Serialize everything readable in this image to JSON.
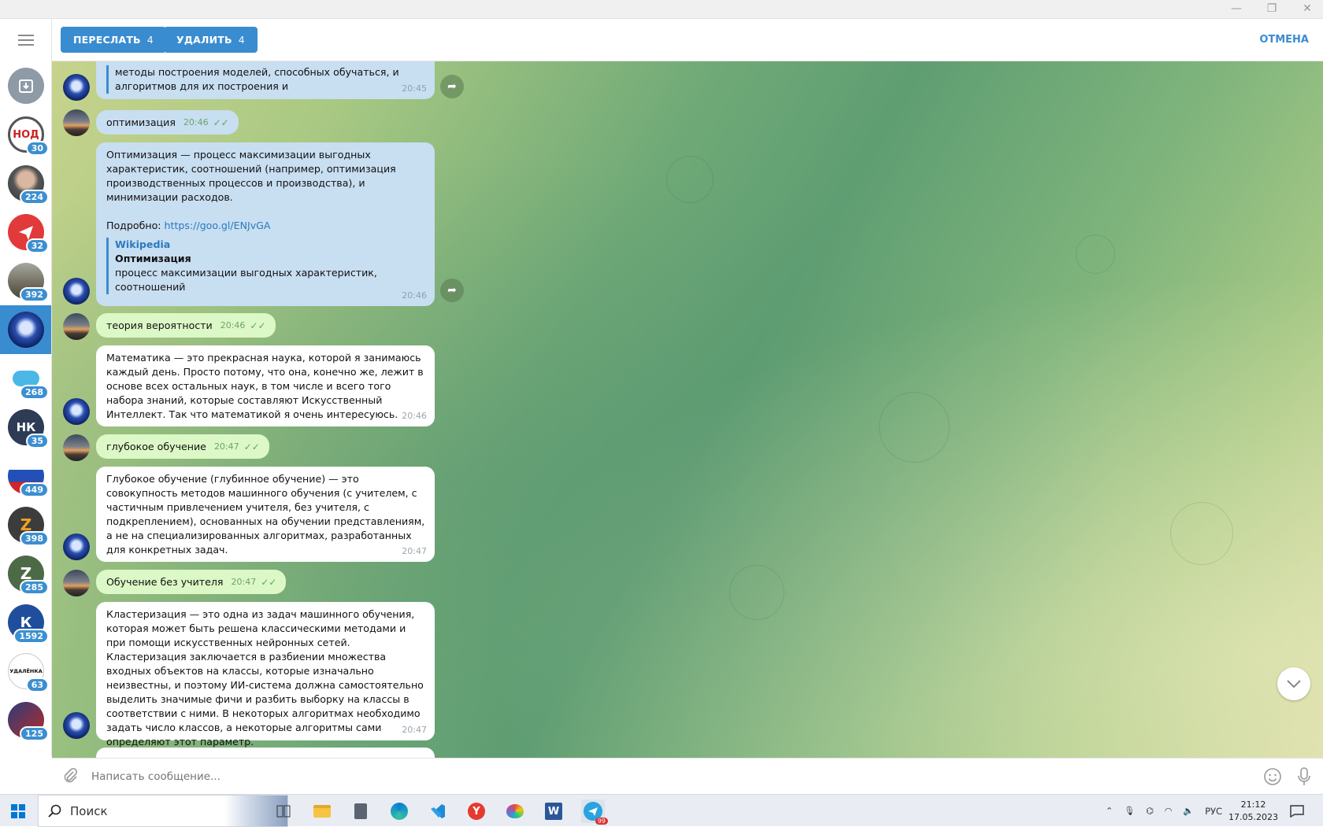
{
  "topbar": {
    "forward_label": "ПЕРЕСЛАТЬ",
    "forward_count": "4",
    "delete_label": "УДАЛИТЬ",
    "delete_count": "4",
    "cancel_label": "ОТМЕНА"
  },
  "sidebar": {
    "chats": [
      {
        "name": "archive",
        "badge": ""
      },
      {
        "name": "nod",
        "badge": "30",
        "label": "НОД"
      },
      {
        "name": "man-portrait",
        "badge": "224"
      },
      {
        "name": "red-channel",
        "badge": "32"
      },
      {
        "name": "soldier",
        "badge": "392"
      },
      {
        "name": "ai-bot",
        "badge": "",
        "active": true
      },
      {
        "name": "cloud",
        "badge": "268"
      },
      {
        "name": "nk",
        "badge": "35",
        "label": "НК"
      },
      {
        "name": "flag-person",
        "badge": "449"
      },
      {
        "name": "z-channel",
        "badge": "398",
        "label": "Z"
      },
      {
        "name": "z-green",
        "badge": "285",
        "label": "Z"
      },
      {
        "name": "k-channel",
        "badge": "1592",
        "label": "К"
      },
      {
        "name": "udalenka",
        "badge": "63",
        "label": "УДАЛЁНКА"
      },
      {
        "name": "news",
        "badge": "125"
      }
    ]
  },
  "messages": {
    "m1_text": "методы построения моделей, способных обучаться, и алгоритмов для их построения и",
    "m1_time": "20:45",
    "m2_text": "оптимизация",
    "m2_time": "20:46",
    "m3_text": "Оптимизация — процесс максимизации выгодных характеристик, соотношений (например, оптимизация производственных процессов и производства), и минимизации расходов.",
    "m3_more_label": "Подробно:",
    "m3_link": "https://goo.gl/ENJvGA",
    "m3_wp_site": "Wikipedia",
    "m3_wp_title": "Оптимизация",
    "m3_wp_desc": "процесс максимизации выгодных характеристик, соотношений",
    "m3_time": "20:46",
    "m4_text": "теория вероятности",
    "m4_time": "20:46",
    "m5_text": "Математика — это прекрасная наука, которой я занимаюсь каждый день. Просто потому, что она, конечно же, лежит в основе всех остальных наук, в том числе и всего того набора знаний, которые составляют Искусственный Интеллект. Так что математикой я очень интересуюсь.",
    "m5_time": "20:46",
    "m6_text": "глубокое обучение",
    "m6_time": "20:47",
    "m7_text": "Глубокое обучение (глубинное обучение) — это совокупность методов машинного обучения (с учителем, с частичным привлечением учителя, без учителя, с подкреплением), основанных на обучении представлениям, а не на специализированных алгоритмах, разработанных для конкретных задач.",
    "m7_time": "20:47",
    "m8_text": "Обучение без учителя",
    "m8_time": "20:47",
    "m9_text": "Кластеризация — это одна из задач машинного обучения, которая может быть решена классическими методами и при помощи искусственных нейронных сетей. Кластеризация заключается в разбиении множества входных объектов на классы, которые изначально неизвестны, и поэтому ИИ-система должна самостоятельно выделить значимые фичи и разбить выборку на классы в соответствии с ними. В некоторых алгоритмах необходимо задать число классов, а некоторые алгоритмы сами определяют этот параметр.",
    "m9_time": "20:47"
  },
  "input": {
    "placeholder": "Написать сообщение..."
  },
  "taskbar": {
    "search_label": "Поиск",
    "lang": "РУС",
    "time": "21:12",
    "date": "17.05.2023",
    "telegram_badge": "99"
  }
}
